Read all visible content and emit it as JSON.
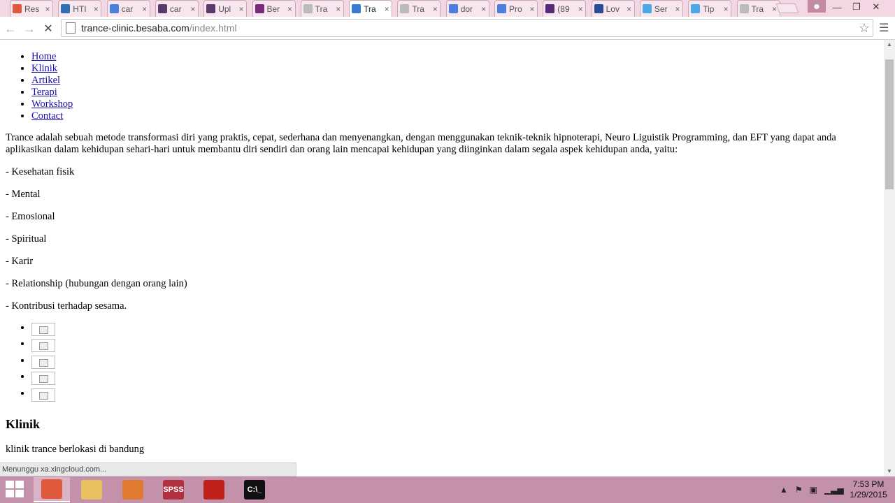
{
  "browser": {
    "tabs": [
      {
        "label": "Res",
        "icon": "chrome-icon",
        "color": "#e0593b"
      },
      {
        "label": "HTI",
        "icon": "w3-icon",
        "color": "#2f6fb5"
      },
      {
        "label": "car",
        "icon": "google-icon",
        "color": "#4a7fe0"
      },
      {
        "label": "car",
        "icon": "doc-icon",
        "color": "#5a3a6a"
      },
      {
        "label": "Upl",
        "icon": "doc-icon",
        "color": "#5a3a6a"
      },
      {
        "label": "Ber",
        "icon": "h-icon",
        "color": "#7a2a7e"
      },
      {
        "label": "Tra",
        "icon": "page-icon",
        "color": "#bbbbbb"
      },
      {
        "label": "Tra",
        "icon": "loading-icon",
        "color": "#3a7ad0"
      },
      {
        "label": "Tra",
        "icon": "page-icon",
        "color": "#bbbbbb"
      },
      {
        "label": "dor",
        "icon": "google-icon",
        "color": "#4a7fe0"
      },
      {
        "label": "Pro",
        "icon": "gear-icon",
        "color": "#4a7fe0"
      },
      {
        "label": "(89",
        "icon": "mail-icon",
        "color": "#5a2a7a"
      },
      {
        "label": "Lov",
        "icon": "l-icon",
        "color": "#2a4a9a"
      },
      {
        "label": "Ser",
        "icon": "twitter-icon",
        "color": "#4aa7e8"
      },
      {
        "label": "Tip",
        "icon": "twitter-icon",
        "color": "#4aa7e8"
      },
      {
        "label": "Tra",
        "icon": "page-icon",
        "color": "#bbbbbb"
      }
    ],
    "active_tab_index": 7,
    "url_host": "trance-clinic.besaba.com",
    "url_path": "/index.html",
    "status_text": "Menunggu xa.xingcloud.com..."
  },
  "page": {
    "nav": [
      "Home",
      "Klinik",
      "Artikel",
      "Terapi",
      "Workshop",
      "Contact"
    ],
    "intro": "Trance adalah sebuah metode transformasi diri yang praktis, cepat, sederhana dan menyenangkan, dengan menggunakan teknik-teknik hipnoterapi, Neuro Liguistik Programming, dan EFT yang dapat anda aplikasikan dalam kehidupan sehari-hari untuk membantu diri sendiri dan orang lain mencapai kehidupan yang diinginkan dalam segala aspek kehidupan anda, yaitu:",
    "aspects": [
      "- Kesehatan fisik",
      "- Mental",
      "- Emosional",
      "- Spiritual",
      "- Karir",
      "- Relationship (hubungan dengan orang lain)",
      "- Kontribusi terhadap sesama."
    ],
    "klinik_heading": "Klinik",
    "klinik_text": "klinik trance berlokasi di bandung"
  },
  "taskbar": {
    "apps": [
      {
        "name": "chrome",
        "label": "",
        "color": "#e0593b"
      },
      {
        "name": "file-explorer",
        "label": "",
        "color": "#e8c060"
      },
      {
        "name": "firefox",
        "label": "",
        "color": "#e07a30"
      },
      {
        "name": "spss",
        "label": "SPSS",
        "color": "#b03040"
      },
      {
        "name": "acrobat",
        "label": "",
        "color": "#c0201a"
      },
      {
        "name": "command-prompt",
        "label": "C:\\_",
        "color": "#111111"
      }
    ],
    "time": "7:53 PM",
    "date": "1/29/2015"
  }
}
